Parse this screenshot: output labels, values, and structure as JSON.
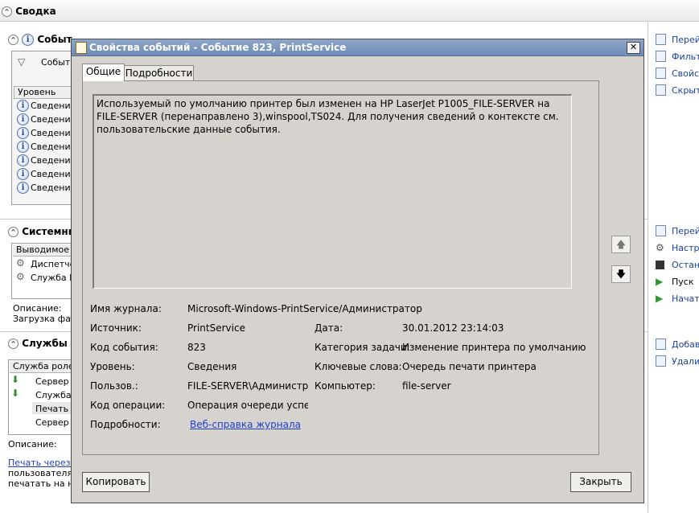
{
  "summary": {
    "title": "Сводка"
  },
  "events_section": {
    "title": "Событ",
    "filter_text": "Событ",
    "column": "Уровень",
    "rows": [
      "Сведения",
      "Сведения",
      "Сведения",
      "Сведения",
      "Сведения",
      "Сведения",
      "Сведения"
    ]
  },
  "system_section": {
    "title": "Системны",
    "column": "Выводимое и",
    "rows": [
      "Диспетче",
      "Служба LF"
    ],
    "description_label": "Описание:",
    "description_text": "Загрузка фай"
  },
  "roles_section": {
    "title": "Службы р",
    "column": "Служба ролей",
    "rows": [
      "Сервер п",
      "Служба",
      "Печать ч",
      "Сервер р"
    ],
    "description_label": "Описание:",
    "link": "Печать через И",
    "text1": "пользователям",
    "text2": "печатать на н"
  },
  "right_actions": {
    "group1": [
      "Перей",
      "Фильтр",
      "Свойс",
      "Скрыт"
    ],
    "group2": [
      "Перей",
      "Настро",
      "Остано",
      "Пуск",
      "Начать"
    ],
    "group3": [
      "Добав",
      "Удалит"
    ]
  },
  "dialog": {
    "title": "Свойства событий - Событие 823, PrintService",
    "close": "✕",
    "tabs": [
      "Общие",
      "Подробности"
    ],
    "description": "Используемый по умолчанию принтер был изменен на HP LaserJet P1005_FILE-SERVER на FILE-SERVER (перенаправлено 3),winspool,TS024. Для получения сведений о контексте см. пользовательские данные события.",
    "fields": {
      "log_name_label": "Имя журнала:",
      "log_name": "Microsoft-Windows-PrintService/Администратор",
      "source_label": "Источник:",
      "source": "PrintService",
      "date_label": "Дата:",
      "date": "30.01.2012 23:14:03",
      "event_id_label": "Код события:",
      "event_id": "823",
      "task_label": "Категория задачи:",
      "task": "Изменение принтера по умолчанию",
      "level_label": "Уровень:",
      "level": "Сведения",
      "keywords_label": "Ключевые слова:",
      "keywords": "Очередь печати принтера",
      "user_label": "Пользов.:",
      "user": "FILE-SERVER\\Администрато",
      "computer_label": "Компьютер:",
      "computer": "file-server",
      "opcode_label": "Код операции:",
      "opcode": "Операция очереди успешн",
      "details_label": "Подробности:",
      "details_link": "Веб-справка журнала"
    },
    "copy_button": "Копировать",
    "close_button": "Закрыть"
  }
}
